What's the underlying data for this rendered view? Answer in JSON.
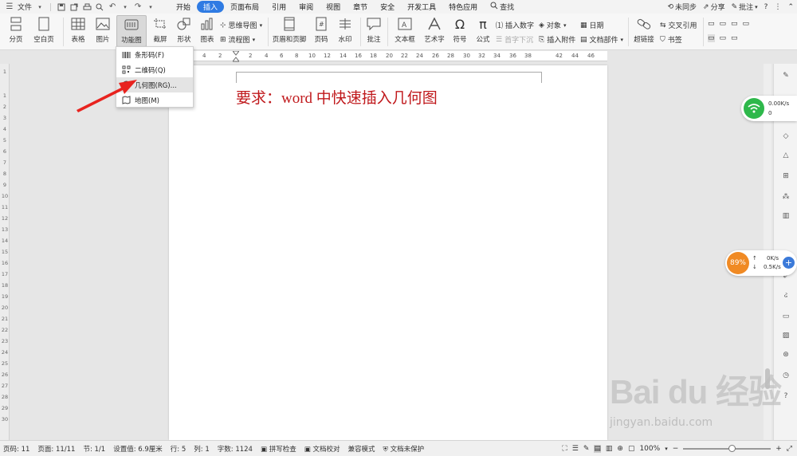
{
  "menubar": {
    "file_label": "文件",
    "tabs": [
      {
        "label": "开始",
        "active": false
      },
      {
        "label": "插入",
        "active": true
      },
      {
        "label": "页面布局",
        "active": false
      },
      {
        "label": "引用",
        "active": false
      },
      {
        "label": "审阅",
        "active": false
      },
      {
        "label": "视图",
        "active": false
      },
      {
        "label": "章节",
        "active": false
      },
      {
        "label": "安全",
        "active": false
      },
      {
        "label": "开发工具",
        "active": false
      },
      {
        "label": "特色应用",
        "active": false
      }
    ],
    "search_label": "查找",
    "sync_label": "未同步",
    "share_label": "分享",
    "comment_label": "批注",
    "help_label": "?",
    "accent_color": "#2f7be3"
  },
  "ribbon": {
    "page_break": "分页",
    "blank_page": "空白页",
    "table": "表格",
    "picture": "图片",
    "function_chart": "功能图",
    "screenshot": "截屏",
    "shapes": "形状",
    "chart": "图表",
    "mind_map": "思维导图",
    "flowchart": "流程图",
    "header_footer": "页眉和页脚",
    "page_number": "页码",
    "watermark": "水印",
    "comment": "批注",
    "textbox": "文本框",
    "art_text": "艺术字",
    "symbol": "符号",
    "formula": "公式",
    "insert_number": "插入数字",
    "drop_cap": "首字下沉",
    "object": "对象",
    "insert_attachment": "插入附件",
    "date": "日期",
    "doc_parts": "文档部件",
    "hyperlink": "超链接",
    "cross_ref": "交叉引用",
    "bookmark": "书签"
  },
  "dropdown": {
    "items": [
      {
        "label": "条形码(F)",
        "icon": "barcode-icon",
        "highlighted": false
      },
      {
        "label": "二维码(Q)",
        "icon": "qrcode-icon",
        "highlighted": false
      },
      {
        "label": "几何图(RG)...",
        "icon": "geometry-icon",
        "highlighted": true
      },
      {
        "label": "地图(M)",
        "icon": "map-icon",
        "highlighted": false
      }
    ]
  },
  "ruler": {
    "numbers": [
      "4",
      "2",
      "",
      "2",
      "4",
      "6",
      "8",
      "10",
      "12",
      "14",
      "16",
      "18",
      "20",
      "22",
      "24",
      "26",
      "28",
      "30",
      "32",
      "34",
      "36",
      "38",
      "",
      "42",
      "44",
      "46"
    ],
    "vertical_numbers": [
      "1",
      "",
      "1",
      "2",
      "3",
      "4",
      "5",
      "6",
      "7",
      "8",
      "9",
      "10",
      "11",
      "12",
      "13",
      "14",
      "15",
      "16",
      "17",
      "18",
      "19",
      "20",
      "21",
      "22",
      "23",
      "24",
      "25",
      "26",
      "27",
      "28",
      "29",
      "30"
    ]
  },
  "document": {
    "title": "要求：word 中快速插入几何图",
    "title_color": "#c0191c"
  },
  "widgets": {
    "wifi_up": "0.00K/s",
    "wifi_down": "0",
    "cpu_percent": "89%",
    "net_up": "0K/s",
    "net_down": "0.5K/s"
  },
  "watermark": {
    "logo": "Bai du 经验",
    "url": "jingyan.baidu.com"
  },
  "statusbar": {
    "page_code": "页码: 11",
    "pages": "页面: 11/11",
    "section": "节: 1/1",
    "setting": "设置值: 6.9厘米",
    "row": "行: 5",
    "col": "列: 1",
    "word_count": "字数: 1124",
    "spell_check": "拼写检查",
    "doc_proof": "文档校对",
    "compat_mode": "兼容模式",
    "doc_protect": "文档未保护",
    "zoom": "100%",
    "zoom_level": 0.55
  }
}
